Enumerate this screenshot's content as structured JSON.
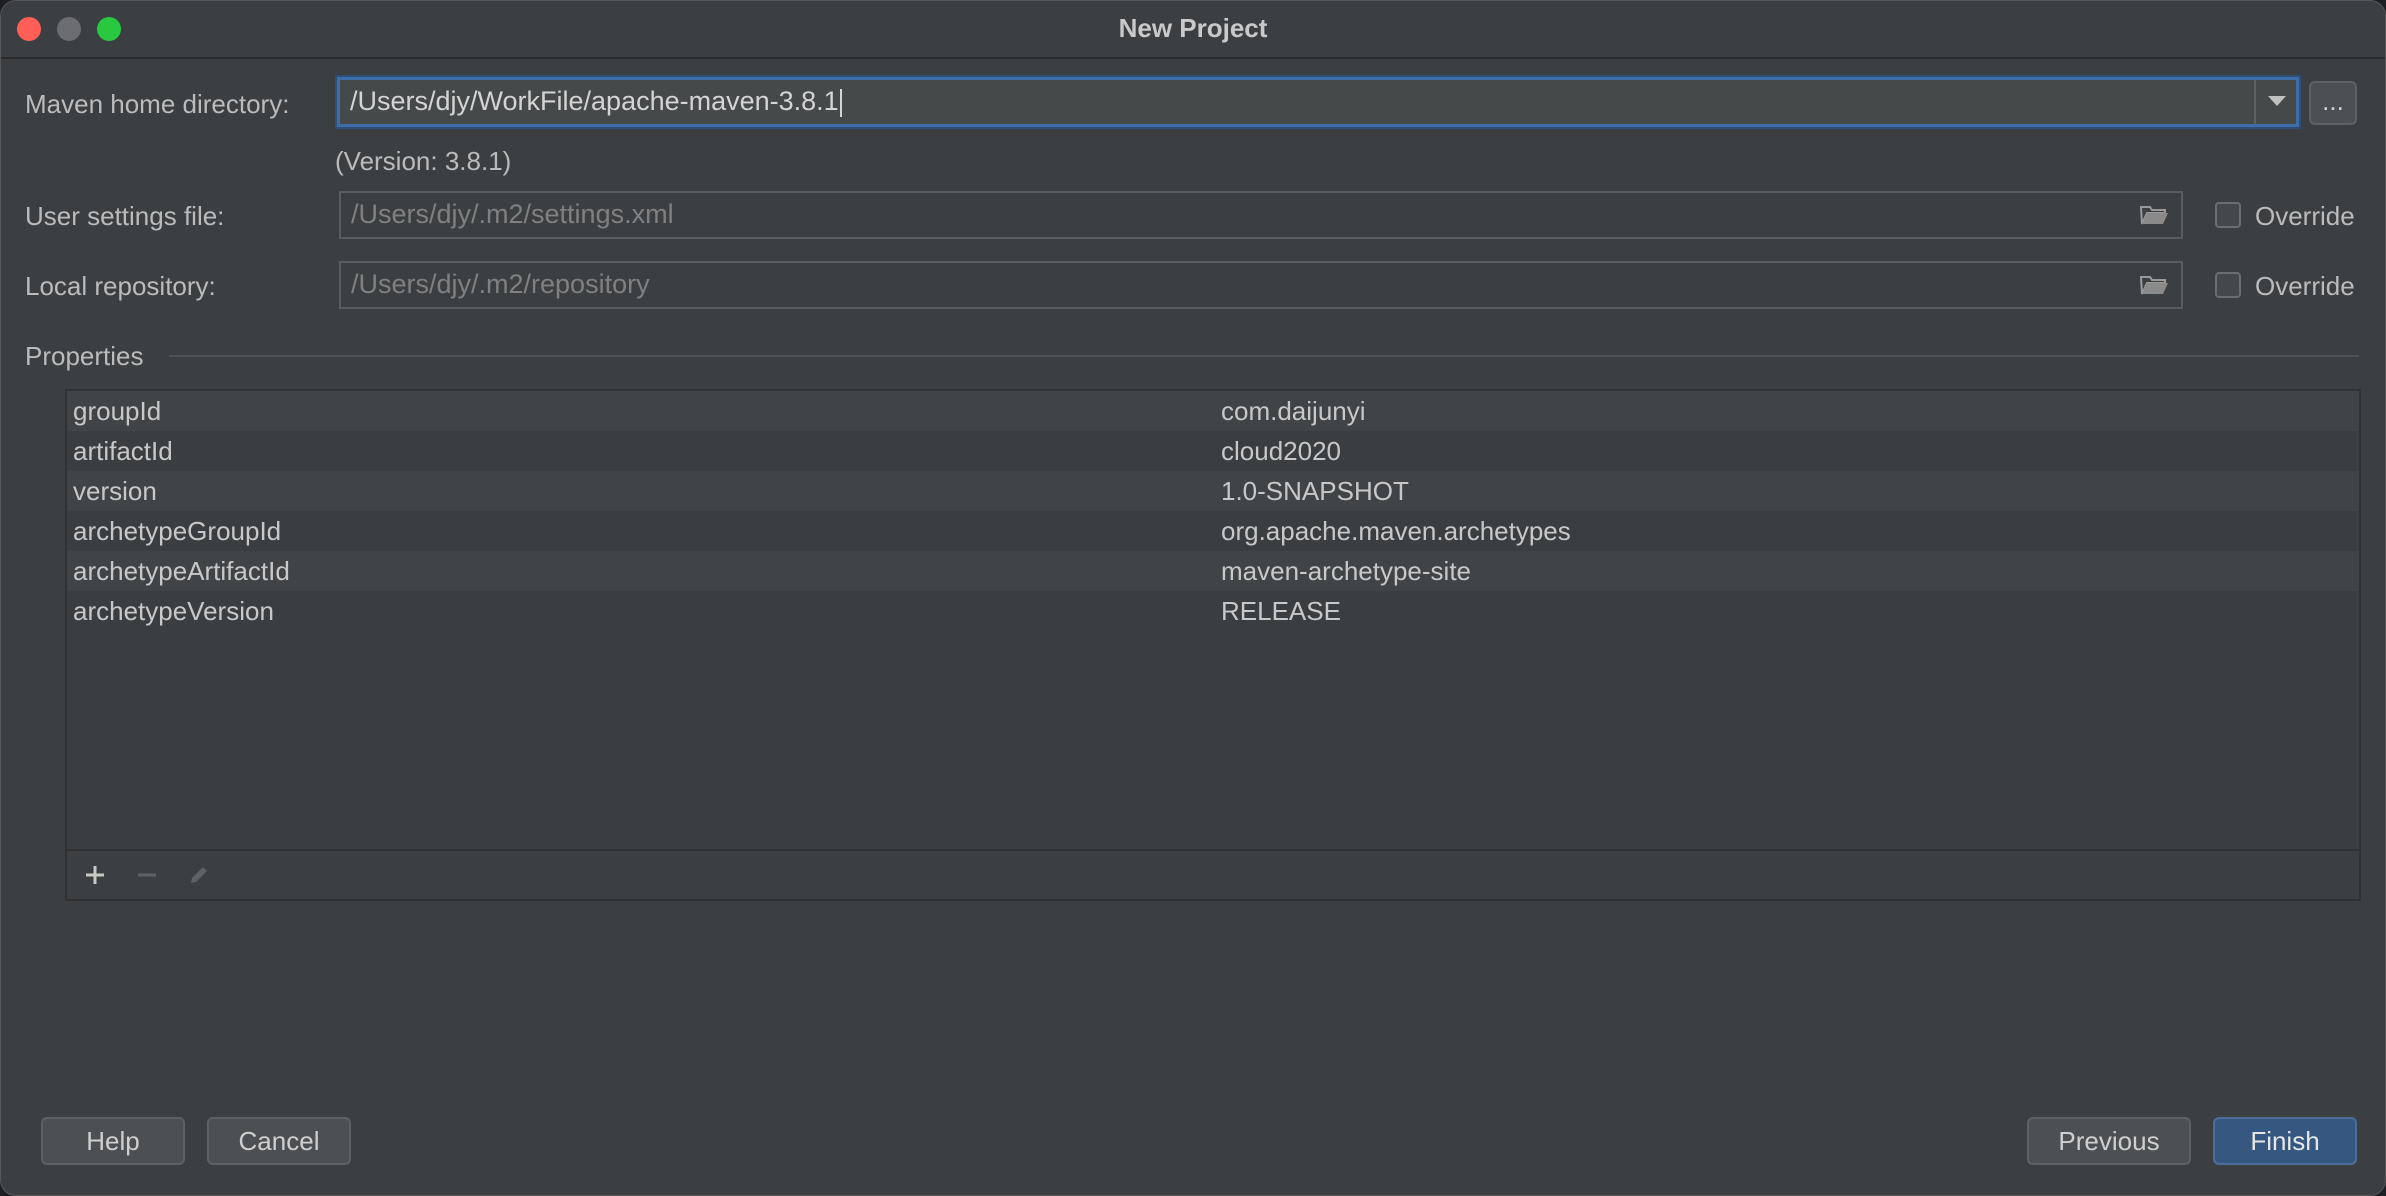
{
  "window": {
    "title": "New Project"
  },
  "form": {
    "maven_home_label": "Maven home directory:",
    "maven_home_value": "/Users/djy/WorkFile/apache-maven-3.8.1",
    "browse_label": "...",
    "version_text": "(Version: 3.8.1)",
    "user_settings_label": "User settings file:",
    "user_settings_value": "/Users/djy/.m2/settings.xml",
    "local_repo_label": "Local repository:",
    "local_repo_value": "/Users/djy/.m2/repository",
    "override_label": "Override"
  },
  "properties": {
    "section_title": "Properties",
    "rows": [
      {
        "key": "groupId",
        "value": "com.daijunyi"
      },
      {
        "key": "artifactId",
        "value": "cloud2020"
      },
      {
        "key": "version",
        "value": "1.0-SNAPSHOT"
      },
      {
        "key": "archetypeGroupId",
        "value": "org.apache.maven.archetypes"
      },
      {
        "key": "archetypeArtifactId",
        "value": "maven-archetype-site"
      },
      {
        "key": "archetypeVersion",
        "value": "RELEASE"
      }
    ]
  },
  "buttons": {
    "help": "Help",
    "cancel": "Cancel",
    "previous": "Previous",
    "finish": "Finish"
  },
  "colors": {
    "background": "#3c3f41",
    "accent": "#365880",
    "focus": "#3d6ea8"
  }
}
